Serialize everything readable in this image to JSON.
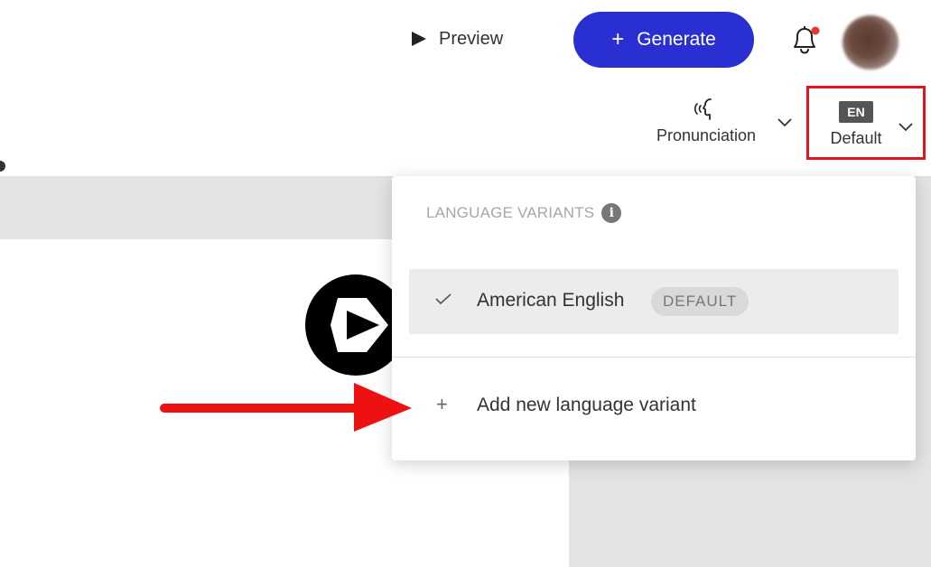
{
  "header": {
    "preview_label": "Preview",
    "generate_label": "Generate",
    "generate_plus": "+",
    "bell_has_notification": true
  },
  "toolbar": {
    "pronunciation_label": "Pronunciation",
    "language_code": "EN",
    "language_label": "Default"
  },
  "dropdown": {
    "heading": "LANGUAGE VARIANTS",
    "info_glyph": "i",
    "variants": [
      {
        "name": "American English",
        "badge": "DEFAULT",
        "selected": true
      }
    ],
    "add_plus": "+",
    "add_label": "Add new language variant"
  },
  "colors": {
    "accent": "#2a2fd1",
    "highlight_border": "#e5121f",
    "notification_dot": "#e53935",
    "annotation_arrow": "#ee1111"
  },
  "icons": {
    "preview": "play-icon",
    "bell": "bell-icon",
    "pronunciation": "speaking-head-icon",
    "chevrons": "chevron-down-icon",
    "check": "check-icon",
    "info": "info-icon"
  }
}
